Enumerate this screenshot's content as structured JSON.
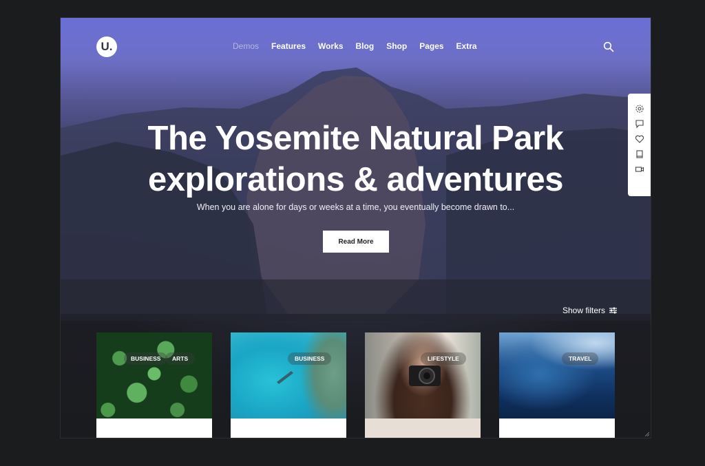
{
  "header": {
    "logo_text": "U.",
    "nav": [
      "Demos",
      "Features",
      "Works",
      "Blog",
      "Shop",
      "Pages",
      "Extra"
    ],
    "active_nav": "Demos",
    "search_icon": "search-icon"
  },
  "hero": {
    "title_line1": "The Yosemite Natural Park",
    "title_line2": "explorations & adventures",
    "subtitle": "When you are alone for days or weeks at a time, you eventually become drawn to...",
    "button_label": "Read More"
  },
  "side_panel": {
    "icons": [
      "gear-icon",
      "comment-icon",
      "heart-icon",
      "book-icon",
      "video-icon"
    ]
  },
  "filters": {
    "label": "Show filters",
    "icon": "sliders-icon"
  },
  "cards": [
    {
      "tags": [
        "BUSINESS",
        "ARTS"
      ]
    },
    {
      "tags": [
        "BUSINESS"
      ]
    },
    {
      "tags": [
        "LIFESTYLE"
      ]
    },
    {
      "tags": [
        "TRAVEL"
      ]
    }
  ],
  "colors": {
    "sky_top": "#6a6fd6",
    "background": "#1a1b1e",
    "active_nav": "#b4b8de",
    "button_bg": "#ffffff"
  }
}
